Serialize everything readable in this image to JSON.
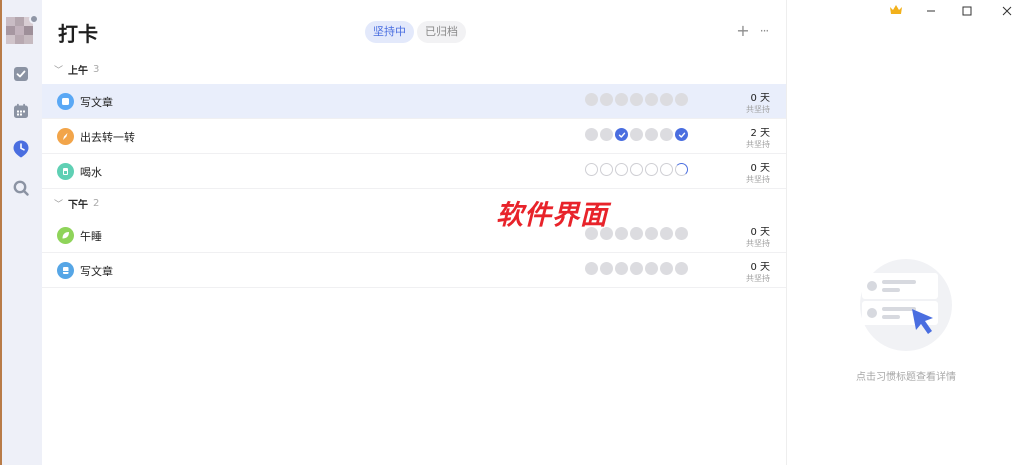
{
  "sidebar": {
    "avatar_colors": [
      "#c9bcc4",
      "#b4a6ae",
      "#d8cdd3",
      "#a797a1",
      "#c2b2bc",
      "#9e8f99",
      "#d0c4ca",
      "#b8a9b1",
      "#c6bac0"
    ],
    "items": [
      {
        "icon": "checkbox-icon",
        "active": false
      },
      {
        "icon": "calendar-icon",
        "active": false
      },
      {
        "icon": "habit-clock-icon",
        "active": true
      },
      {
        "icon": "search-icon",
        "active": false
      }
    ]
  },
  "header": {
    "title": "打卡",
    "tabs": [
      {
        "label": "坚持中",
        "active": true
      },
      {
        "label": "已归档",
        "active": false
      }
    ],
    "add_icon": "+",
    "more_icon": "···"
  },
  "groups": [
    {
      "name": "上午",
      "count": "3",
      "habits": [
        {
          "title": "写文章",
          "icon": "doc-icon",
          "icon_bg": "#5aa8f5",
          "days": "0 天",
          "streak": "共坚持",
          "selected": true,
          "week": [
            "off",
            "off",
            "off",
            "off",
            "off",
            "off",
            "off"
          ]
        },
        {
          "title": "出去转一转",
          "icon": "compass-icon",
          "icon_bg": "#f2a54a",
          "days": "2 天",
          "streak": "共坚持",
          "selected": false,
          "week": [
            "off",
            "off",
            "done",
            "off",
            "off",
            "off",
            "done"
          ]
        },
        {
          "title": "喝水",
          "icon": "cup-icon",
          "icon_bg": "#5fd0b4",
          "days": "0 天",
          "streak": "共坚持",
          "selected": false,
          "week": [
            "empty",
            "empty",
            "empty",
            "empty",
            "empty",
            "empty",
            "progress"
          ]
        }
      ]
    },
    {
      "name": "下午",
      "count": "2",
      "habits": [
        {
          "title": "午睡",
          "icon": "leaf-icon",
          "icon_bg": "#8fd45a",
          "days": "0 天",
          "streak": "共坚持",
          "selected": false,
          "week": [
            "off",
            "off",
            "off",
            "off",
            "off",
            "off",
            "off"
          ]
        },
        {
          "title": "写文章",
          "icon": "notebook-icon",
          "icon_bg": "#56a6e6",
          "days": "0 天",
          "streak": "共坚持",
          "selected": false,
          "week": [
            "off",
            "off",
            "off",
            "off",
            "off",
            "off",
            "off"
          ]
        }
      ]
    }
  ],
  "watermark": "软件界面",
  "detail": {
    "hint": "点击习惯标题查看详情",
    "window_controls": [
      "crown-icon",
      "minimize-icon",
      "maximize-icon",
      "close-icon"
    ]
  },
  "colors": {
    "accent": "#4a6ee0",
    "sidebar_bg": "#eef0f8",
    "selected_row": "#e9eefb"
  }
}
